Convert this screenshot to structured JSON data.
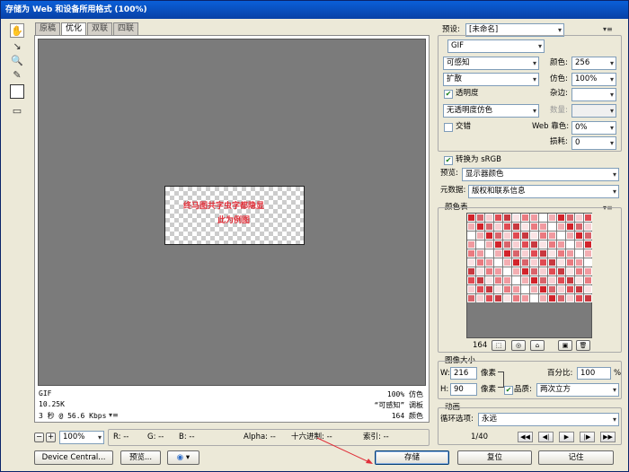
{
  "window": {
    "title": "存储为 Web 和设备所用格式 (100%)"
  },
  "tabs": [
    "原稿",
    "优化",
    "双联",
    "四联"
  ],
  "active_tab": 1,
  "preview_text": {
    "line1": "终马图共字虫字都隐显",
    "line2": "此为例图"
  },
  "info_left": {
    "format": "GIF",
    "size": "10.25K",
    "time": "3 秒 @ 56.6 Kbps"
  },
  "info_right": {
    "quality": "100% 仿色",
    "palette": "“可感知” 调板",
    "colors": "164 颜色"
  },
  "status_bar": {
    "zoom": "100%",
    "r": "R: --",
    "g": "G: --",
    "b": "B: --",
    "alpha": "Alpha: --",
    "hex": "十六进制: --",
    "index": "索引: --"
  },
  "bottom_buttons": {
    "device_central": "Device Central...",
    "preview": "预览...",
    "save": "存储",
    "reset": "复位",
    "remember": "记住"
  },
  "settings": {
    "preset_label": "预设:",
    "preset_value": "[未命名]",
    "format": "GIF",
    "reduction": "可感知",
    "colors_label": "颜色:",
    "colors_value": "256",
    "dither_algo": "扩散",
    "dither_label": "仿色:",
    "dither_value": "100%",
    "transparency_label": "透明度",
    "matte_label": "杂边:",
    "matte_value": "",
    "trans_dither": "无透明度仿色",
    "amount_label": "数量:",
    "amount_value": "",
    "interlaced_label": "交错",
    "web_snap_label": "Web 靠色:",
    "web_snap_value": "0%",
    "lossy_label": "损耗:",
    "lossy_value": "0",
    "convert_srgb_label": "转换为 sRGB",
    "preview_label": "预览:",
    "preview_value": "显示器颜色",
    "metadata_label": "元数据:",
    "metadata_value": "版权和联系信息"
  },
  "color_table": {
    "title": "颜色表",
    "count": "164"
  },
  "image_size": {
    "title": "图像大小",
    "w_label": "W:",
    "w_value": "216",
    "h_label": "H:",
    "h_value": "90",
    "unit": "像素",
    "percent_label": "百分比:",
    "percent_value": "100",
    "percent_unit": "%",
    "quality_label": "品质:",
    "quality_value": "两次立方"
  },
  "animation": {
    "title": "动画",
    "loop_label": "循环选项:",
    "loop_value": "永远",
    "frame": "1/40"
  },
  "colors": {
    "accent_red": "#e0303a",
    "title_blue": "#0a5fd8"
  }
}
